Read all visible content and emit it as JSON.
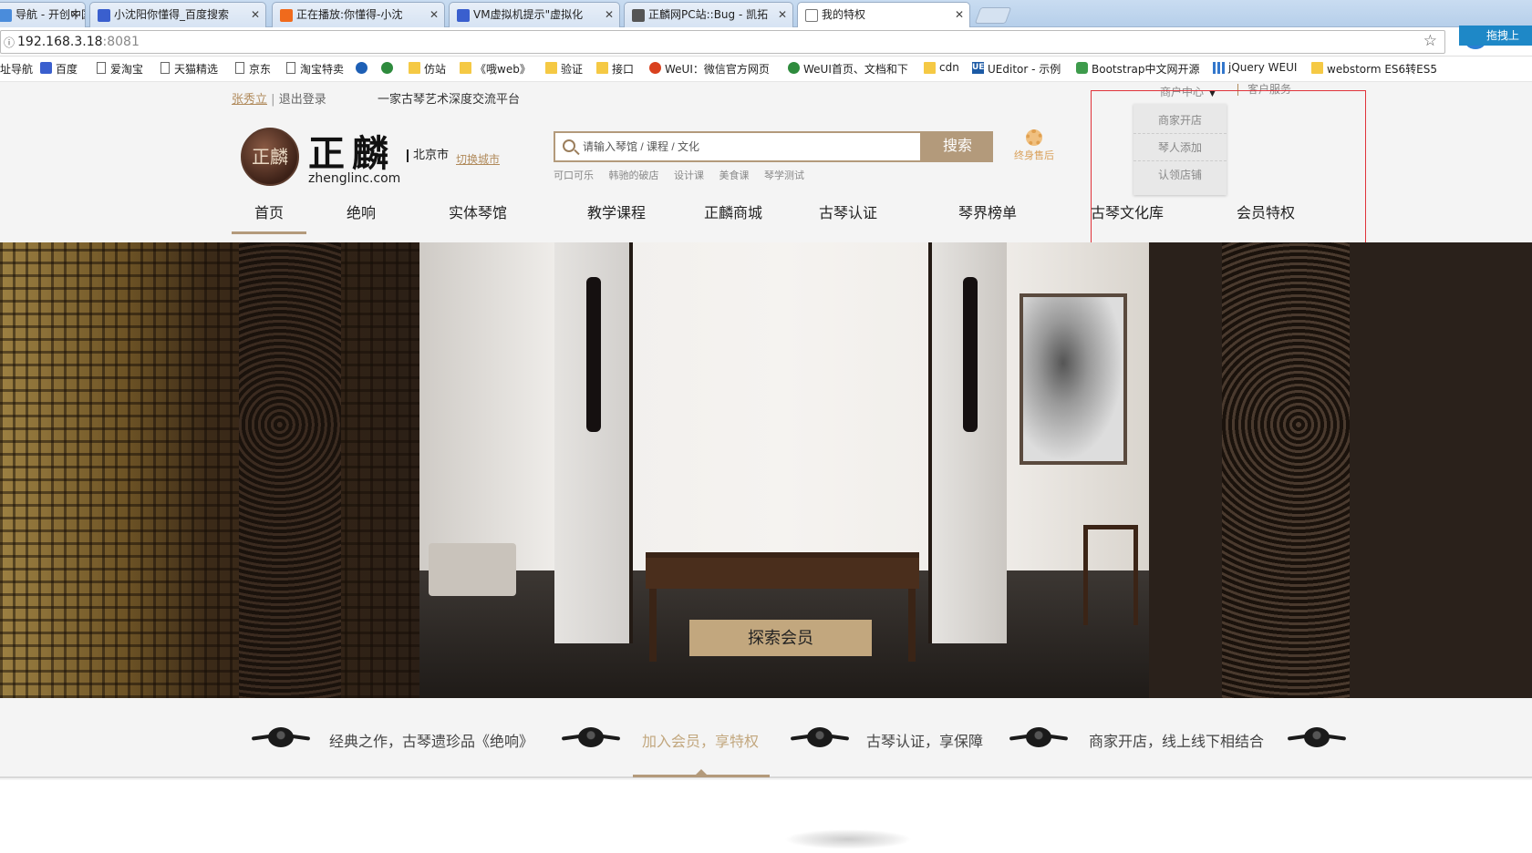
{
  "browser": {
    "tabs": [
      {
        "title": "导航 - 开创中国",
        "favicon_color": "#4a8cdb"
      },
      {
        "title": "小沈阳你懂得_百度搜索",
        "favicon_color": "#3a5fce"
      },
      {
        "title": "正在播放:你懂得-小沈",
        "favicon_color": "#f06a1c"
      },
      {
        "title": "VM虚拟机提示\"虚拟化",
        "favicon_color": "#3a5fce"
      },
      {
        "title": "正麟网PC站::Bug - 凯拓",
        "favicon_color": "#555555"
      },
      {
        "title": "我的特权",
        "favicon_color": "#ffffff"
      }
    ],
    "extension_label": "拖拽上",
    "address": {
      "host": "192.168.3.18",
      "port": ":8081"
    },
    "bookmarks": [
      {
        "label": "址导航",
        "icon": "page-icon"
      },
      {
        "label": "百度",
        "icon": "paw-icon"
      },
      {
        "label": "爱淘宝",
        "icon": "page-icon"
      },
      {
        "label": "天猫精选",
        "icon": "page-icon"
      },
      {
        "label": "京东",
        "icon": "page-icon"
      },
      {
        "label": "淘宝特卖",
        "icon": "page-icon"
      },
      {
        "label": "",
        "icon": "chrome-icon"
      },
      {
        "label": "",
        "icon": "chrome-icon"
      },
      {
        "label": "仿站",
        "icon": "folder-icon"
      },
      {
        "label": "《哦web》",
        "icon": "folder-icon"
      },
      {
        "label": "验证",
        "icon": "folder-icon"
      },
      {
        "label": "接口",
        "icon": "folder-icon"
      },
      {
        "label": "WeUI：微信官方网页",
        "icon": "weui-icon"
      },
      {
        "label": "WeUI首页、文档和下",
        "icon": "chrome-icon"
      },
      {
        "label": "cdn",
        "icon": "folder-icon"
      },
      {
        "label": "UEditor - 示例",
        "icon": "ue-icon"
      },
      {
        "label": "Bootstrap中文网开源",
        "icon": "bootstrap-icon"
      },
      {
        "label": "jQuery WEUI",
        "icon": "grid-icon"
      },
      {
        "label": "webstorm ES6转ES5",
        "icon": "folder-icon"
      }
    ]
  },
  "site": {
    "user_name": "张秀立",
    "separator": "|",
    "logout": "退出登录",
    "slogan": "一家古琴艺术深度交流平台",
    "logo_seal": "正麟",
    "logo_name": "正麟",
    "logo_domain": "zhenglinc.com",
    "city": "北京市",
    "switch_city": "切换城市",
    "search": {
      "placeholder": "请输入琴馆 / 课程 / 文化",
      "button": "搜索",
      "hot_words": [
        "可口可乐",
        "韩驰的破店",
        "设计课",
        "美食课",
        "琴学测试"
      ]
    },
    "after_sale": "终身售后",
    "merchant_center": "商户中心",
    "customer_service": "客户服务",
    "merchant_dropdown": [
      "商家开店",
      "琴人添加",
      "认领店铺"
    ],
    "nav": [
      "首页",
      "绝响",
      "实体琴馆",
      "教学课程",
      "正麟商城",
      "古琴认证",
      "琴界榜单",
      "古琴文化库",
      "会员特权"
    ],
    "hero_button": "探索会员",
    "features": [
      "经典之作，古琴遗珍品《绝响》",
      "加入会员，享特权",
      "古琴认证，享保障",
      "商家开店，线上线下相结合"
    ],
    "accent_color": "#b39a7b"
  }
}
